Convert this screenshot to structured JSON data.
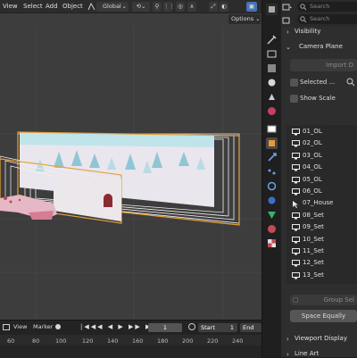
{
  "viewport": {
    "menu": {
      "view": "View",
      "select": "Select",
      "add": "Add",
      "object": "Object"
    },
    "orientation": "Global",
    "options_label": "Options"
  },
  "timeline": {
    "menu": {
      "view": "View",
      "marker": "Marker"
    },
    "current_frame": "1",
    "start_label": "Start",
    "start_value": "1",
    "end_label": "End",
    "ticks": [
      "60",
      "80",
      "100",
      "120",
      "140",
      "160",
      "180",
      "200",
      "220",
      "240"
    ]
  },
  "props": {
    "search_placeholder": "Search",
    "sections": {
      "visibility": "Visibility",
      "camera_plane": "Camera Plane",
      "viewport_display": "Viewport Display",
      "line_art": "Line Art"
    },
    "import_button": "Import D",
    "selected_label": "Selected ...",
    "show_scale_label": "Show Scale",
    "group_select_label": "Group Sel",
    "space_equally_label": "Space Equally",
    "collections": [
      {
        "name": "01_OL",
        "icon": "monitor-icon"
      },
      {
        "name": "02_OL",
        "icon": "monitor-icon"
      },
      {
        "name": "03_OL",
        "icon": "monitor-icon"
      },
      {
        "name": "04_OL",
        "icon": "monitor-icon"
      },
      {
        "name": "05_OL",
        "icon": "monitor-icon"
      },
      {
        "name": "06_OL",
        "icon": "monitor-icon"
      },
      {
        "name": "07_House",
        "icon": "cursor-icon"
      },
      {
        "name": "08_Set",
        "icon": "monitor-icon"
      },
      {
        "name": "09_Set",
        "icon": "monitor-icon"
      },
      {
        "name": "10_Set",
        "icon": "monitor-icon"
      },
      {
        "name": "11_Set",
        "icon": "monitor-icon"
      },
      {
        "name": "12_Set",
        "icon": "monitor-icon"
      },
      {
        "name": "13_Set",
        "icon": "monitor-icon"
      }
    ]
  },
  "colors": {
    "accent_blue": "#4772b3",
    "camera_orange": "#e8a13a",
    "viewport_bg": "#3d3d3d"
  }
}
